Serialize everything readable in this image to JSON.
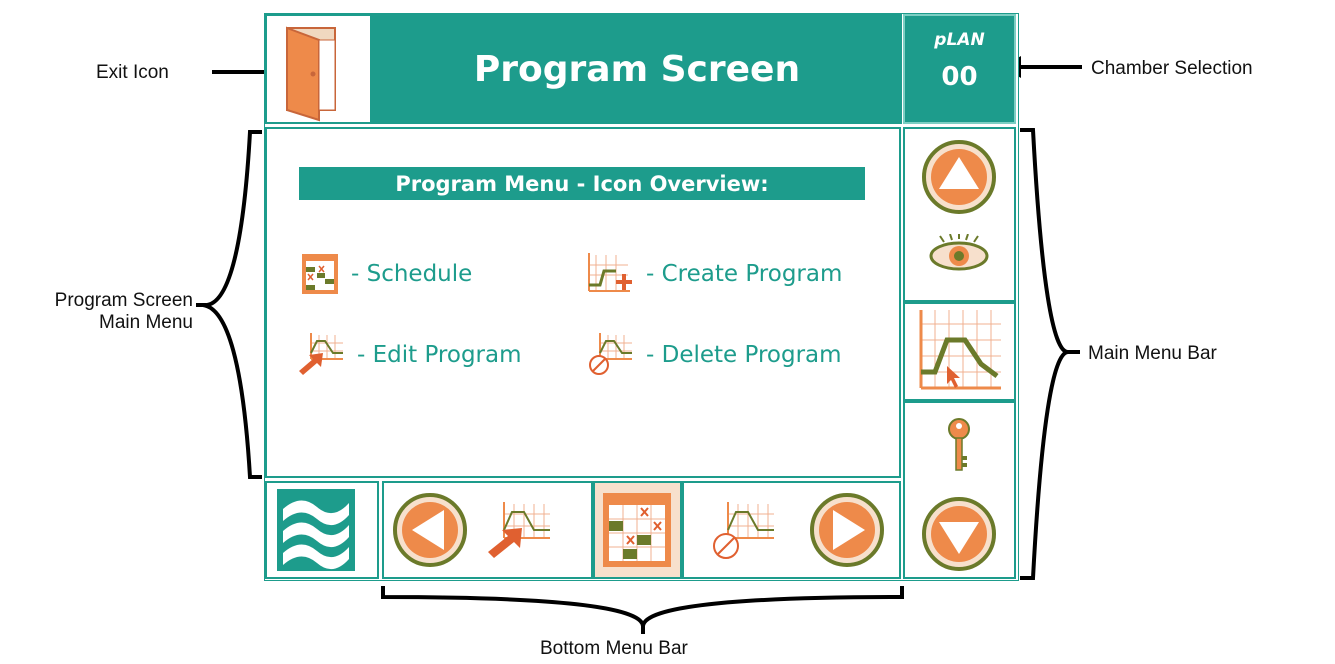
{
  "annotations": {
    "exit_icon": "Exit Icon",
    "chamber_selection": "Chamber Selection",
    "main_menu_line1": "Program Screen",
    "main_menu_line2": "Main Menu",
    "main_menu_bar": "Main Menu Bar",
    "bottom_menu_bar": "Bottom Menu Bar"
  },
  "screen": {
    "title": "Program Screen",
    "plan_label": "pLAN",
    "plan_number": "00"
  },
  "main_menu": {
    "heading": "Program Menu - Icon Overview:",
    "items": [
      {
        "icon": "schedule-icon",
        "label": "- Schedule"
      },
      {
        "icon": "create-program-icon",
        "label": "- Create Program"
      },
      {
        "icon": "edit-program-icon",
        "label": "- Edit Program"
      },
      {
        "icon": "delete-program-icon",
        "label": "- Delete Program"
      }
    ]
  },
  "side_bar": {
    "icons": [
      "up-arrow-icon",
      "view-eye-icon",
      "program-graph-icon",
      "key-icon",
      "down-arrow-icon"
    ]
  },
  "bottom_bar": {
    "icons": [
      "logo-icon",
      "left-arrow-icon",
      "edit-program-icon",
      "schedule-icon",
      "delete-program-icon",
      "right-arrow-icon"
    ]
  },
  "colors": {
    "teal": "#1d9c8c",
    "orange": "#ee8a4a",
    "olive": "#6b7a2a",
    "white": "#ffffff"
  }
}
